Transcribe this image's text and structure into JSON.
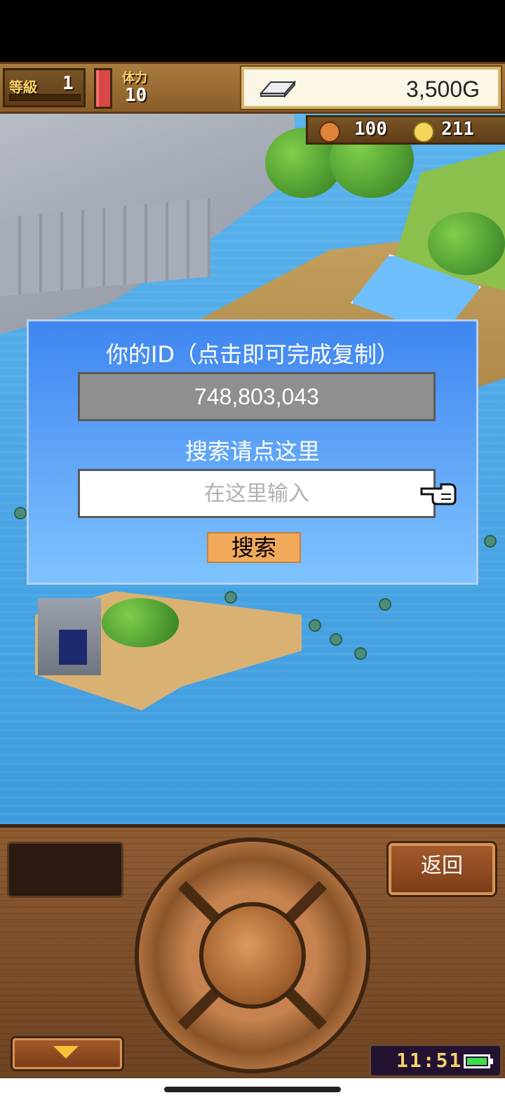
{
  "hud": {
    "level_label": "等級",
    "level_value": "1",
    "stamina_label": "体力",
    "stamina_value": "10",
    "gold_value": "3,500G",
    "meat_value": "100",
    "coin_value": "211"
  },
  "dialog": {
    "id_title": "你的ID（点击即可完成复制）",
    "id_value": "748,803,043",
    "search_title": "搜索请点这里",
    "search_placeholder": "在这里输入",
    "search_button": "搜索"
  },
  "panel": {
    "back_button": "返回",
    "clock": "11:51"
  },
  "icons": {
    "gold": "silver-ingot-icon",
    "meat": "meat-icon",
    "coin": "coin-icon",
    "pointer": "pointing-hand-icon",
    "toggle": "arrow-down-icon",
    "battery": "battery-icon"
  },
  "colors": {
    "dialog_top": "#3f86f0",
    "dialog_bottom": "#7fc3ff",
    "search_button_bg": "#f1a95a",
    "id_field_bg": "#8f8f8f",
    "panel_wood": "#8e5c32",
    "battery_green": "#3ddc4d"
  }
}
